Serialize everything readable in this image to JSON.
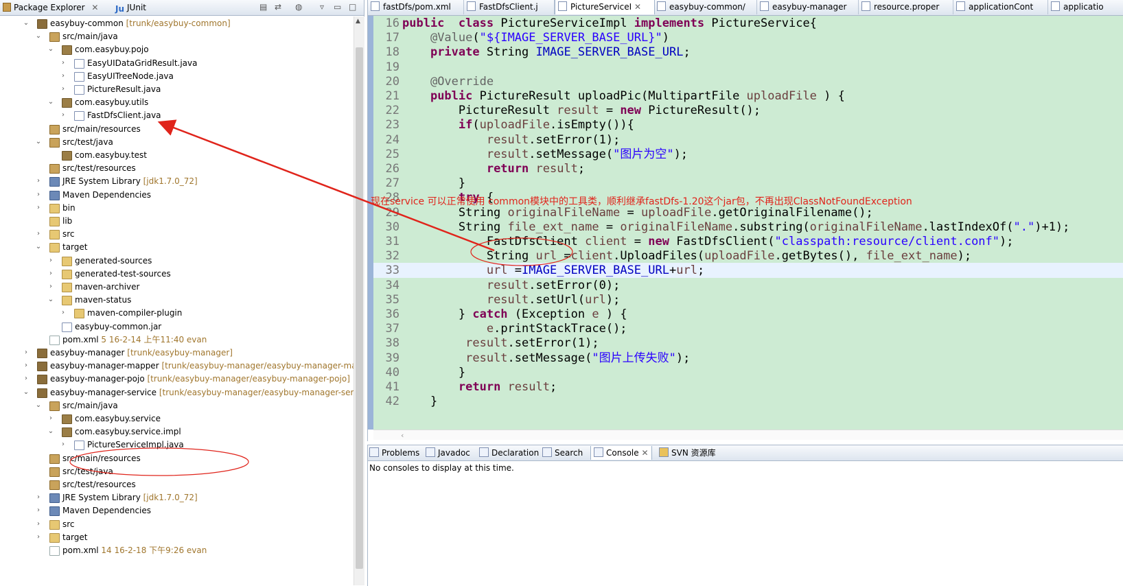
{
  "package_explorer": {
    "tab_label": "Package Explorer",
    "junit_tab_label": "JUnit",
    "tree": [
      {
        "label": "easybuy-common",
        "decor": "[trunk/easybuy-common]",
        "depth": 0,
        "twisty": "open",
        "icon": "project"
      },
      {
        "label": "src/main/java",
        "decor": "",
        "depth": 1,
        "twisty": "open",
        "icon": "source-folder"
      },
      {
        "label": "com.easybuy.pojo",
        "decor": "",
        "depth": 2,
        "twisty": "open",
        "icon": "package"
      },
      {
        "label": "EasyUIDataGridResult.java",
        "decor": "",
        "depth": 3,
        "twisty": "closed",
        "icon": "java-file"
      },
      {
        "label": "EasyUITreeNode.java",
        "decor": "",
        "depth": 3,
        "twisty": "closed",
        "icon": "java-file"
      },
      {
        "label": "PictureResult.java",
        "decor": "",
        "depth": 3,
        "twisty": "closed",
        "icon": "java-file"
      },
      {
        "label": "com.easybuy.utils",
        "decor": "",
        "depth": 2,
        "twisty": "open",
        "icon": "package"
      },
      {
        "label": "FastDfsClient.java",
        "decor": "",
        "depth": 3,
        "twisty": "closed",
        "icon": "java-file"
      },
      {
        "label": "src/main/resources",
        "decor": "",
        "depth": 1,
        "twisty": "none",
        "icon": "source-folder"
      },
      {
        "label": "src/test/java",
        "decor": "",
        "depth": 1,
        "twisty": "open",
        "icon": "source-folder"
      },
      {
        "label": "com.easybuy.test",
        "decor": "",
        "depth": 2,
        "twisty": "none",
        "icon": "package"
      },
      {
        "label": "src/test/resources",
        "decor": "",
        "depth": 1,
        "twisty": "none",
        "icon": "source-folder"
      },
      {
        "label": "JRE System Library",
        "decor": "[jdk1.7.0_72]",
        "depth": 1,
        "twisty": "closed",
        "icon": "library"
      },
      {
        "label": "Maven Dependencies",
        "decor": "",
        "depth": 1,
        "twisty": "closed",
        "icon": "library"
      },
      {
        "label": "bin",
        "decor": "",
        "depth": 1,
        "twisty": "closed",
        "icon": "folder"
      },
      {
        "label": "lib",
        "decor": "",
        "depth": 1,
        "twisty": "none",
        "icon": "folder"
      },
      {
        "label": "src",
        "decor": "",
        "depth": 1,
        "twisty": "closed",
        "icon": "folder"
      },
      {
        "label": "target",
        "decor": "",
        "depth": 1,
        "twisty": "open",
        "icon": "folder"
      },
      {
        "label": "generated-sources",
        "decor": "",
        "depth": 2,
        "twisty": "closed",
        "icon": "folder"
      },
      {
        "label": "generated-test-sources",
        "decor": "",
        "depth": 2,
        "twisty": "closed",
        "icon": "folder"
      },
      {
        "label": "maven-archiver",
        "decor": "",
        "depth": 2,
        "twisty": "closed",
        "icon": "folder"
      },
      {
        "label": "maven-status",
        "decor": "",
        "depth": 2,
        "twisty": "open",
        "icon": "folder"
      },
      {
        "label": "maven-compiler-plugin",
        "decor": "",
        "depth": 3,
        "twisty": "closed",
        "icon": "folder"
      },
      {
        "label": "easybuy-common.jar",
        "decor": "",
        "depth": 2,
        "twisty": "none",
        "icon": "jar-file"
      },
      {
        "label": "pom.xml",
        "decor": "5  16-2-14 上午11:40  evan",
        "depth": 1,
        "twisty": "none",
        "icon": "xml-file"
      },
      {
        "label": "easybuy-manager",
        "decor": "[trunk/easybuy-manager]",
        "depth": 0,
        "twisty": "closed",
        "icon": "project"
      },
      {
        "label": "easybuy-manager-mapper",
        "decor": "[trunk/easybuy-manager/easybuy-manager-map",
        "depth": 0,
        "twisty": "closed",
        "icon": "project"
      },
      {
        "label": "easybuy-manager-pojo",
        "decor": "[trunk/easybuy-manager/easybuy-manager-pojo]",
        "depth": 0,
        "twisty": "closed",
        "icon": "project"
      },
      {
        "label": "easybuy-manager-service",
        "decor": "[trunk/easybuy-manager/easybuy-manager-servic",
        "depth": 0,
        "twisty": "open",
        "icon": "project"
      },
      {
        "label": "src/main/java",
        "decor": "",
        "depth": 1,
        "twisty": "open",
        "icon": "source-folder"
      },
      {
        "label": "com.easybuy.service",
        "decor": "",
        "depth": 2,
        "twisty": "closed",
        "icon": "package"
      },
      {
        "label": "com.easybuy.service.impl",
        "decor": "",
        "depth": 2,
        "twisty": "open",
        "icon": "package"
      },
      {
        "label": "PictureServiceImpl.java",
        "decor": "",
        "depth": 3,
        "twisty": "closed",
        "icon": "java-file"
      },
      {
        "label": "src/main/resources",
        "decor": "",
        "depth": 1,
        "twisty": "none",
        "icon": "source-folder"
      },
      {
        "label": "src/test/java",
        "decor": "",
        "depth": 1,
        "twisty": "none",
        "icon": "source-folder"
      },
      {
        "label": "src/test/resources",
        "decor": "",
        "depth": 1,
        "twisty": "none",
        "icon": "source-folder"
      },
      {
        "label": "JRE System Library",
        "decor": "[jdk1.7.0_72]",
        "depth": 1,
        "twisty": "closed",
        "icon": "library"
      },
      {
        "label": "Maven Dependencies",
        "decor": "",
        "depth": 1,
        "twisty": "closed",
        "icon": "library"
      },
      {
        "label": "src",
        "decor": "",
        "depth": 1,
        "twisty": "closed",
        "icon": "folder"
      },
      {
        "label": "target",
        "decor": "",
        "depth": 1,
        "twisty": "closed",
        "icon": "folder"
      },
      {
        "label": "pom.xml",
        "decor": "14  16-2-18 下午9:26  evan",
        "depth": 1,
        "twisty": "none",
        "icon": "xml-file"
      }
    ]
  },
  "editor": {
    "tabs": [
      {
        "label": "fastDfs/pom.xml",
        "icon": "maven-pom-icon",
        "active": false
      },
      {
        "label": "FastDfsClient.j",
        "icon": "java-file-icon",
        "active": false
      },
      {
        "label": "PictureServiceI",
        "icon": "java-file-icon",
        "active": true
      },
      {
        "label": "easybuy-common/",
        "icon": "maven-pom-icon",
        "active": false
      },
      {
        "label": "easybuy-manager",
        "icon": "maven-pom-icon",
        "active": false
      },
      {
        "label": "resource.proper",
        "icon": "properties-file-icon",
        "active": false
      },
      {
        "label": "applicationCont",
        "icon": "xml-file-icon",
        "active": false
      },
      {
        "label": "applicatio",
        "icon": "xml-file-icon",
        "active": false
      }
    ],
    "lines": [
      {
        "no": "16",
        "segs": [
          [
            "kw",
            "public"
          ],
          [
            "",
            "  "
          ],
          [
            "kw",
            "class"
          ],
          [
            "",
            " PictureServiceImpl "
          ],
          [
            "kw",
            "implements"
          ],
          [
            "",
            " PictureService{"
          ]
        ]
      },
      {
        "no": "17",
        "segs": [
          [
            "",
            "    "
          ],
          [
            "ann",
            "@Value"
          ],
          [
            "",
            "("
          ],
          [
            "str",
            "\"${IMAGE_SERVER_BASE_URL}\""
          ],
          [
            "",
            ")"
          ]
        ]
      },
      {
        "no": "18",
        "segs": [
          [
            "",
            "    "
          ],
          [
            "kw",
            "private"
          ],
          [
            "",
            " String "
          ],
          [
            "fld",
            "IMAGE_SERVER_BASE_URL"
          ],
          [
            "",
            ";"
          ]
        ]
      },
      {
        "no": "19",
        "segs": []
      },
      {
        "no": "20",
        "segs": [
          [
            "",
            "    "
          ],
          [
            "ann",
            "@Override"
          ]
        ]
      },
      {
        "no": "21",
        "segs": [
          [
            "",
            "    "
          ],
          [
            "kw",
            "public"
          ],
          [
            "",
            " PictureResult uploadPic(MultipartFile "
          ],
          [
            "vr",
            "uploadFile"
          ],
          [
            "",
            " ) {"
          ]
        ]
      },
      {
        "no": "22",
        "segs": [
          [
            "",
            "        PictureResult "
          ],
          [
            "vr",
            "result"
          ],
          [
            "",
            " = "
          ],
          [
            "kw",
            "new"
          ],
          [
            "",
            " PictureResult();"
          ]
        ]
      },
      {
        "no": "23",
        "segs": [
          [
            "",
            "        "
          ],
          [
            "kw",
            "if"
          ],
          [
            "",
            "("
          ],
          [
            "vr",
            "uploadFile"
          ],
          [
            "",
            ".isEmpty()){"
          ]
        ]
      },
      {
        "no": "24",
        "segs": [
          [
            "",
            "            "
          ],
          [
            "vr",
            "result"
          ],
          [
            "",
            ".setError(1);"
          ]
        ]
      },
      {
        "no": "25",
        "segs": [
          [
            "",
            "            "
          ],
          [
            "vr",
            "result"
          ],
          [
            "",
            ".setMessage("
          ],
          [
            "str",
            "\"图片为空\""
          ],
          [
            "",
            ");"
          ]
        ]
      },
      {
        "no": "26",
        "segs": [
          [
            "",
            "            "
          ],
          [
            "kw",
            "return"
          ],
          [
            "",
            " "
          ],
          [
            "vr",
            "result"
          ],
          [
            "",
            ";"
          ]
        ]
      },
      {
        "no": "27",
        "segs": [
          [
            "",
            "        }"
          ]
        ]
      },
      {
        "no": "28",
        "segs": [
          [
            "",
            "        "
          ],
          [
            "kw",
            "try"
          ],
          [
            "",
            " {"
          ]
        ]
      },
      {
        "no": "29",
        "segs": [
          [
            "",
            "        String "
          ],
          [
            "vr",
            "originalFileName"
          ],
          [
            "",
            " = "
          ],
          [
            "vr",
            "uploadFile"
          ],
          [
            "",
            ".getOriginalFilename();"
          ]
        ]
      },
      {
        "no": "30",
        "segs": [
          [
            "",
            "        String "
          ],
          [
            "vr",
            "file_ext_name"
          ],
          [
            "",
            " = "
          ],
          [
            "vr",
            "originalFileName"
          ],
          [
            "",
            ".substring("
          ],
          [
            "vr",
            "originalFileName"
          ],
          [
            "",
            ".lastIndexOf("
          ],
          [
            "str",
            "\".\""
          ],
          [
            "",
            ")+1);"
          ]
        ]
      },
      {
        "no": "31",
        "segs": [
          [
            "",
            "            FastDfsClient "
          ],
          [
            "vr",
            "client"
          ],
          [
            "",
            " = "
          ],
          [
            "kw",
            "new"
          ],
          [
            "",
            " FastDfsClient("
          ],
          [
            "str",
            "\"classpath:resource/client.conf\""
          ],
          [
            "",
            ");"
          ]
        ]
      },
      {
        "no": "32",
        "segs": [
          [
            "",
            "            String "
          ],
          [
            "vr",
            "url"
          ],
          [
            "",
            " ="
          ],
          [
            "vr",
            "client"
          ],
          [
            "",
            ".UploadFiles("
          ],
          [
            "vr",
            "uploadFile"
          ],
          [
            "",
            ".getBytes(), "
          ],
          [
            "vr",
            "file_ext_name"
          ],
          [
            "",
            ");"
          ]
        ]
      },
      {
        "no": "33",
        "segs": [
          [
            "",
            "            "
          ],
          [
            "vr",
            "url"
          ],
          [
            "",
            " ="
          ],
          [
            "fld",
            "IMAGE_SERVER_BASE_URL"
          ],
          [
            "",
            "+"
          ],
          [
            "vr",
            "url"
          ],
          [
            "",
            ";"
          ]
        ]
      },
      {
        "no": "34",
        "segs": [
          [
            "",
            "            "
          ],
          [
            "vr",
            "result"
          ],
          [
            "",
            ".setError(0);"
          ]
        ]
      },
      {
        "no": "35",
        "segs": [
          [
            "",
            "            "
          ],
          [
            "vr",
            "result"
          ],
          [
            "",
            ".setUrl("
          ],
          [
            "vr",
            "url"
          ],
          [
            "",
            ");"
          ]
        ]
      },
      {
        "no": "36",
        "segs": [
          [
            "",
            "        } "
          ],
          [
            "kw",
            "catch"
          ],
          [
            "",
            " (Exception "
          ],
          [
            "vr",
            "e"
          ],
          [
            "",
            " ) {"
          ]
        ]
      },
      {
        "no": "37",
        "segs": [
          [
            "",
            "            "
          ],
          [
            "vr",
            "e"
          ],
          [
            "",
            ".printStackTrace();"
          ]
        ]
      },
      {
        "no": "38",
        "segs": [
          [
            "",
            "         "
          ],
          [
            "vr",
            "result"
          ],
          [
            "",
            ".setError(1);"
          ]
        ]
      },
      {
        "no": "39",
        "segs": [
          [
            "",
            "         "
          ],
          [
            "vr",
            "result"
          ],
          [
            "",
            ".setMessage("
          ],
          [
            "str",
            "\"图片上传失败\""
          ],
          [
            "",
            ");"
          ]
        ]
      },
      {
        "no": "40",
        "segs": [
          [
            "",
            "        }"
          ]
        ]
      },
      {
        "no": "41",
        "segs": [
          [
            "",
            "        "
          ],
          [
            "kw",
            "return"
          ],
          [
            "",
            " "
          ],
          [
            "vr",
            "result"
          ],
          [
            "",
            ";"
          ]
        ]
      },
      {
        "no": "42",
        "segs": [
          [
            "",
            "    }"
          ]
        ]
      }
    ],
    "current_line": "33"
  },
  "bottom_panel": {
    "tabs": [
      {
        "label": "Problems",
        "icon": "problems-icon",
        "active": false
      },
      {
        "label": "Javadoc",
        "icon": "javadoc-icon",
        "active": false
      },
      {
        "label": "Declaration",
        "icon": "declaration-icon",
        "active": false
      },
      {
        "label": "Search",
        "icon": "search-icon",
        "active": false
      },
      {
        "label": "Console",
        "icon": "console-icon",
        "active": true
      },
      {
        "label": "SVN 资源库",
        "icon": "svn-icon",
        "active": false
      }
    ],
    "console_message": "No consoles to display at this time."
  },
  "annotation": {
    "text": "现在service 可以正常使用 common模块中的工具类，顺利继承fastDfs-1.20这个jar包，不再出现ClassNotFoundException",
    "color": "#e0241b"
  }
}
